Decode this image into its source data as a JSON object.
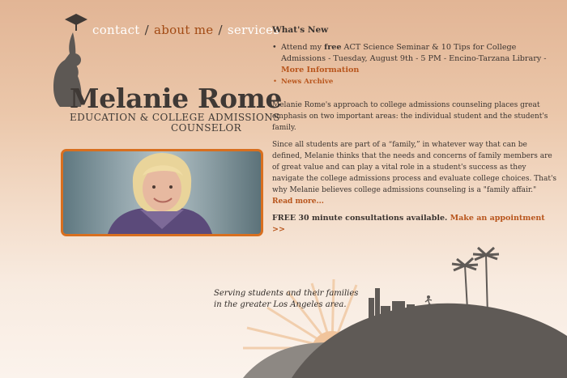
{
  "nav": {
    "contact": "contact",
    "about": "about me",
    "services": "services",
    "sep": "/"
  },
  "brand": {
    "name": "Melanie Rome",
    "tag_line1": "EDUCATION & COLLEGE ADMISSIONS",
    "tag_line2": "COUNSELOR"
  },
  "news": {
    "heading": "What's New",
    "item_prefix": "Attend my ",
    "item_free": "free",
    "item_text": " ACT Science Seminar & 10 Tips for College Admissions - Tuesday, August 9th - 5 PM - Encino-Tarzana Library - ",
    "item_link": "More Information",
    "archive_link": "News Archive"
  },
  "content": {
    "para1": "Melanie Rome's approach to college admissions counseling places great emphasis on two important areas: the individual student and the student's family.",
    "para2": "Since all students are part of a “family,” in whatever way that can be defined, Melanie thinks that the needs and concerns of family members are of great value and can play a vital role in a student's success as they navigate the college admissions process and evaluate college choices. That's why Melanie believes college admissions counseling is a \"family affair.\" ",
    "read_more": "Read more...",
    "free_text": "FREE 30 minute consultations available. ",
    "appointment_link": "Make an appointment >>"
  },
  "tagline": {
    "line1": "Serving students and their families",
    "line2": "in the greater Los Angeles area."
  },
  "colors": {
    "accent": "#b8551c",
    "photo_border": "#d86f1f",
    "silhouette": "#605b57"
  }
}
